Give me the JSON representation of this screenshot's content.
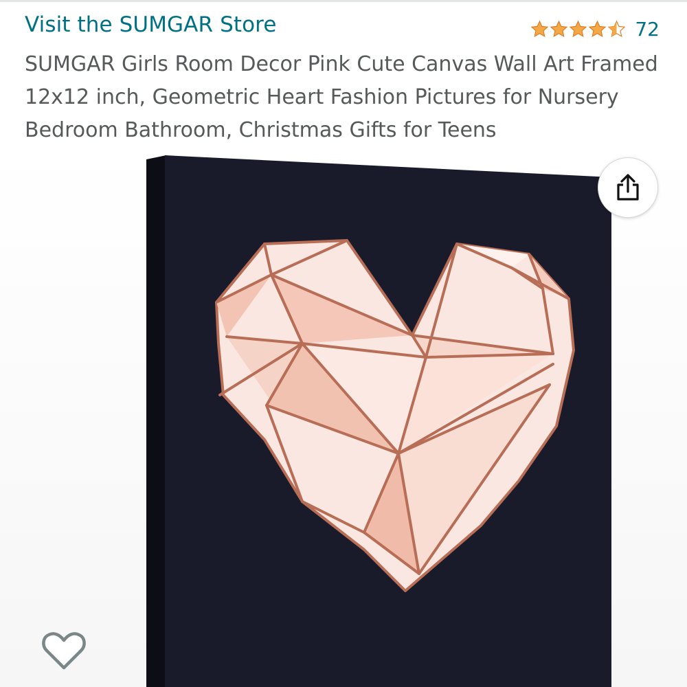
{
  "product": {
    "store_link": "Visit the SUMGAR Store",
    "rating": {
      "stars": 4.5,
      "count": "72"
    },
    "title": "SUMGAR Girls Room Decor Pink Cute Canvas Wall Art Framed 12x12 inch, Geometric Heart Fashion Pictures for Nursery Bedroom Bathroom, Christmas Gifts for Teens"
  },
  "icons": {
    "star": "star-icon",
    "share": "share-icon",
    "wishlist": "heart-outline-icon"
  },
  "colors": {
    "link": "#007185",
    "title_text": "#565959",
    "star": "#f3a847",
    "canvas": "#1a1b2a",
    "heart_fill": "#fbe7e1",
    "heart_lines": "#b86e56"
  }
}
